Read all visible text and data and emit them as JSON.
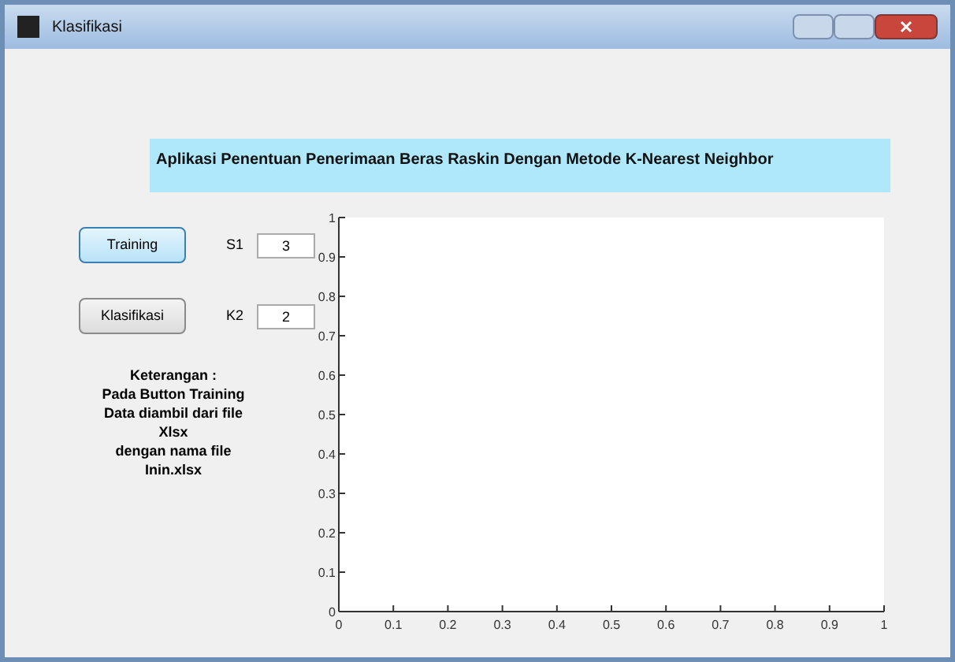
{
  "window": {
    "title": "Klasifikasi"
  },
  "banner": {
    "title": "Aplikasi Penentuan Penerimaan Beras Raskin Dengan Metode K-Nearest Neighbor"
  },
  "buttons": [
    {
      "label": "Training",
      "selected": true
    },
    {
      "label": "Klasifikasi",
      "selected": false
    }
  ],
  "fields": [
    {
      "label": "S1",
      "value": "3"
    },
    {
      "label": "K2",
      "value": "2"
    }
  ],
  "note": [
    "Keterangan :",
    "Pada Button Training",
    "Data diambil dari file",
    "Xlsx",
    "dengan nama file",
    "Inin.xlsx"
  ],
  "plot": {
    "chart_data": {
      "type": "line",
      "xlim": [
        0,
        1
      ],
      "ylim": [
        0,
        1
      ],
      "xticks": [
        0,
        0.1,
        0.2,
        0.3,
        0.4,
        0.5,
        0.6,
        0.7,
        0.8,
        0.9,
        1
      ],
      "yticks": [
        0,
        0.1,
        0.2,
        0.3,
        0.4,
        0.5,
        0.6,
        0.7,
        0.8,
        0.9,
        1
      ]
    }
  }
}
